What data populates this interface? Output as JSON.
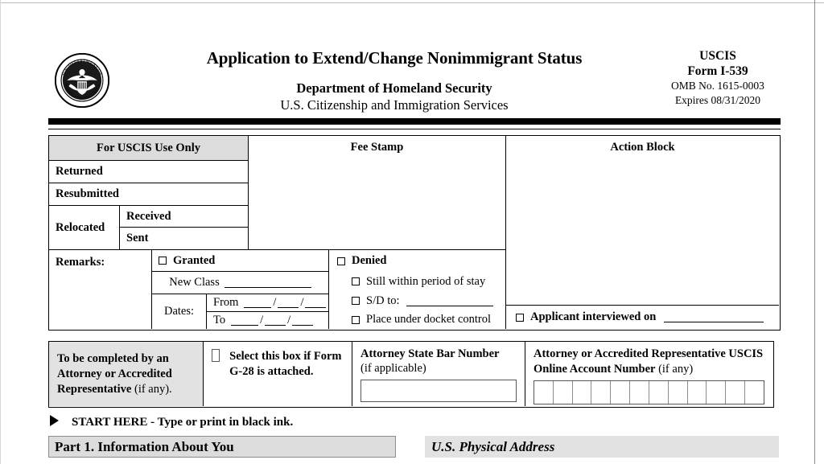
{
  "header": {
    "seal_alt": "dhs-seal",
    "title": "Application to Extend/Change Nonimmigrant Status",
    "agency": "Department of Homeland Security",
    "bureau": "U.S. Citizenship and Immigration Services",
    "uscis_label": "USCIS",
    "form_number": "Form I-539",
    "omb": "OMB No. 1615-0003",
    "expires": "Expires 08/31/2020"
  },
  "uscis_use_only": {
    "header": "For USCIS Use Only",
    "returned": "Returned",
    "resubmitted": "Resubmitted",
    "relocated": "Relocated",
    "received": "Received",
    "sent": "Sent",
    "remarks": "Remarks:",
    "fee_stamp": "Fee Stamp",
    "action_block": "Action Block",
    "granted": "Granted",
    "new_class": "New Class",
    "dates": "Dates:",
    "from": "From",
    "to": "To",
    "date_slash": "/",
    "denied": "Denied",
    "still_within": "Still within period of stay",
    "sd_to": "S/D to:",
    "docket": "Place under docket control",
    "interviewed": "Applicant interviewed on"
  },
  "attorney": {
    "completed_by_bold": "To be completed by an Attorney or Accredited Representative",
    "completed_by_reg": " (if any).",
    "g28_text": "Select this box if Form G-28 is attached.",
    "bar_number_bold": "Attorney State Bar Number",
    "bar_number_reg": "(if applicable)",
    "bar_number_value": "",
    "online_account_bold": "Attorney or Accredited Representative USCIS Online Account Number",
    "online_account_reg": " (if any)",
    "online_account_cells": 12
  },
  "footer": {
    "start_here": "START HERE - Type or print in black ink.",
    "part1": "Part 1.  Information About You",
    "physical_address": "U.S. Physical Address"
  }
}
